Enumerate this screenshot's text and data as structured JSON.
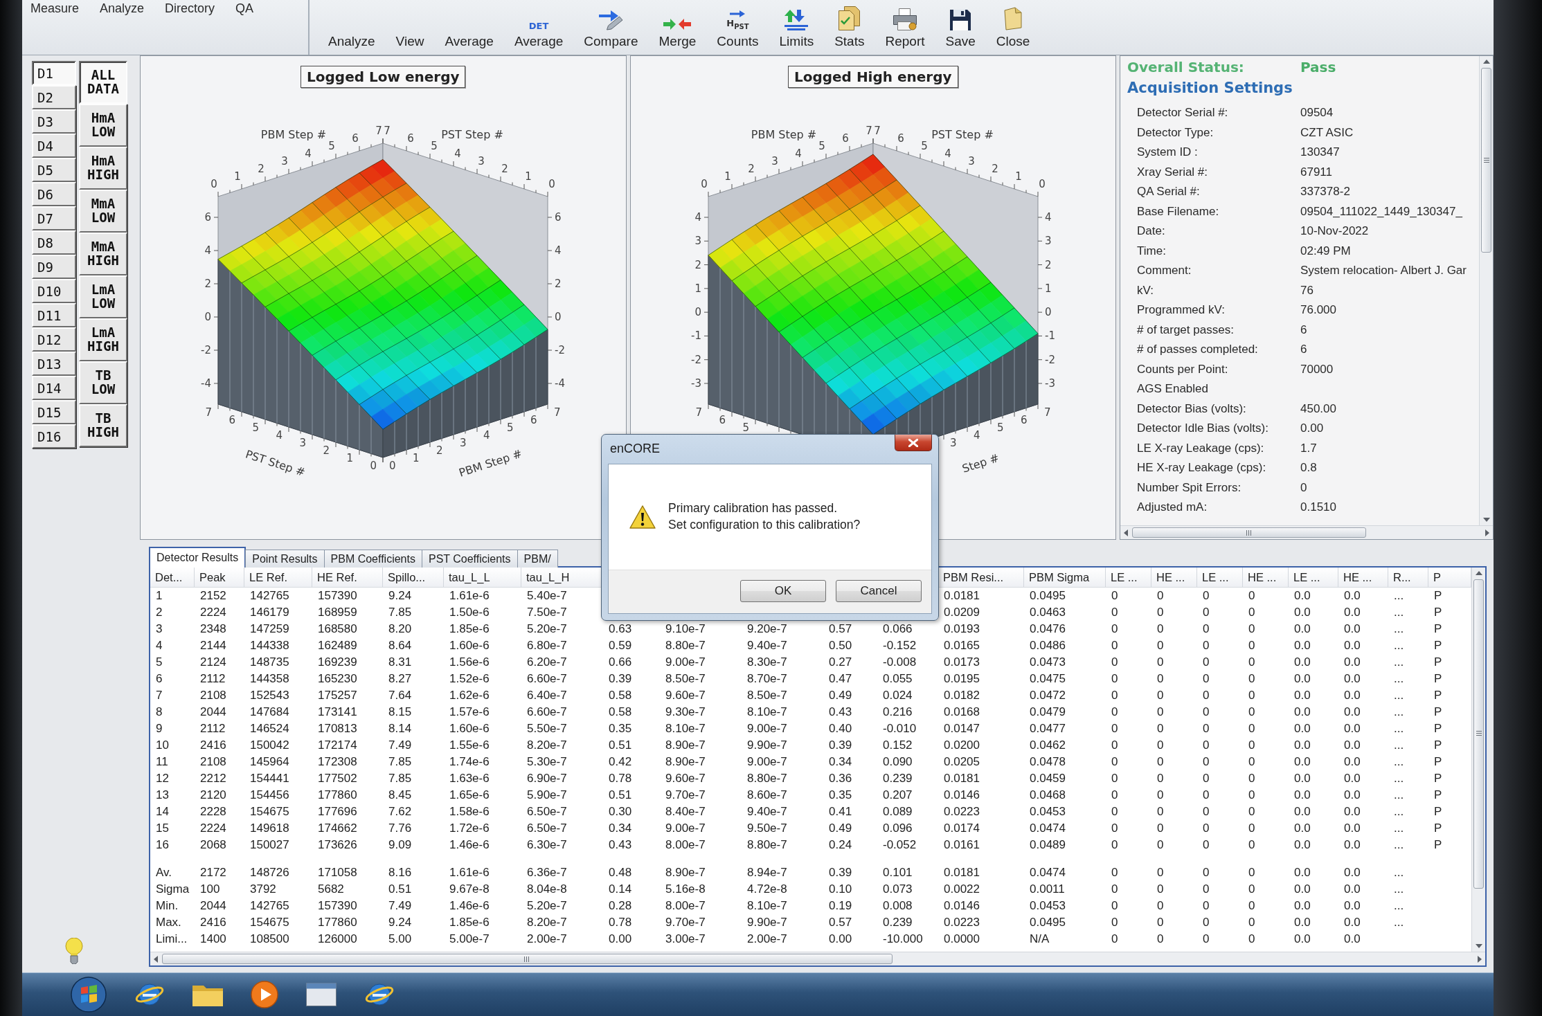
{
  "menu": [
    {
      "label": "Measure"
    },
    {
      "label": "Analyze"
    },
    {
      "label": "Directory"
    },
    {
      "label": "QA"
    }
  ],
  "toolbar": [
    {
      "label": "Analyze",
      "kind": "plain"
    },
    {
      "label": "View",
      "kind": "plain"
    },
    {
      "label": "Average",
      "kind": "plain"
    },
    {
      "label": "Average",
      "kind": "det",
      "icon_text": "DET"
    },
    {
      "label": "Compare",
      "kind": "compare"
    },
    {
      "label": "Merge",
      "kind": "merge"
    },
    {
      "label": "Counts",
      "kind": "counts",
      "icon_text": "H$_{PST}$"
    },
    {
      "label": "Limits",
      "kind": "limits"
    },
    {
      "label": "Stats",
      "kind": "stats"
    },
    {
      "label": "Report",
      "kind": "report"
    },
    {
      "label": "Save",
      "kind": "save"
    },
    {
      "label": "Close",
      "kind": "close"
    }
  ],
  "detector_buttons": [
    {
      "label": "D1",
      "selected": true
    },
    {
      "label": "D2",
      "selected": false
    },
    {
      "label": "D3",
      "selected": false
    },
    {
      "label": "D4",
      "selected": false
    },
    {
      "label": "D5",
      "selected": false
    },
    {
      "label": "D6",
      "selected": false
    },
    {
      "label": "D7",
      "selected": false
    },
    {
      "label": "D8",
      "selected": false
    },
    {
      "label": "D9",
      "selected": false
    },
    {
      "label": "D10",
      "selected": false
    },
    {
      "label": "D11",
      "selected": false
    },
    {
      "label": "D12",
      "selected": false
    },
    {
      "label": "D13",
      "selected": false
    },
    {
      "label": "D14",
      "selected": false
    },
    {
      "label": "D15",
      "selected": false
    },
    {
      "label": "D16",
      "selected": false
    }
  ],
  "mode_buttons": [
    {
      "label": "ALL DATA",
      "selected": true
    },
    {
      "label": "HmA LOW",
      "selected": false
    },
    {
      "label": "HmA HIGH",
      "selected": false
    },
    {
      "label": "MmA LOW",
      "selected": false
    },
    {
      "label": "MmA HIGH",
      "selected": false
    },
    {
      "label": "LmA LOW",
      "selected": false
    },
    {
      "label": "LmA HIGH",
      "selected": false
    },
    {
      "label": "TB LOW",
      "selected": false
    },
    {
      "label": "TB HIGH",
      "selected": false
    }
  ],
  "charts": [
    {
      "title": "Logged Low energy",
      "top_axes": [
        {
          "label": "PBM Step #",
          "ticks": [
            "0",
            "1",
            "2",
            "3",
            "4",
            "5",
            "6",
            "7"
          ]
        },
        {
          "label": "PST Step #",
          "ticks": [
            "7",
            "6",
            "5",
            "4",
            "3",
            "2",
            "1",
            "0"
          ]
        }
      ],
      "left_ticks": [
        "6",
        "4",
        "2",
        "0",
        "-2",
        "-4"
      ],
      "right_ticks": [
        "6",
        "4",
        "2",
        "0",
        "-2",
        "-4"
      ],
      "bottom_axes": [
        {
          "label": "PST Step #",
          "ticks": [
            "7",
            "6",
            "5",
            "4",
            "3",
            "2",
            "1",
            "0"
          ]
        },
        {
          "label": "PBM Step #",
          "ticks": [
            "0",
            "1",
            "2",
            "3",
            "4",
            "5",
            "6",
            "7"
          ]
        }
      ]
    },
    {
      "title": "Logged High energy",
      "top_axes": [
        {
          "label": "PBM Step #",
          "ticks": [
            "0",
            "1",
            "2",
            "3",
            "4",
            "5",
            "6",
            "7"
          ]
        },
        {
          "label": "PST Step #",
          "ticks": [
            "7",
            "6",
            "5",
            "4",
            "3",
            "2",
            "1",
            "0"
          ]
        }
      ],
      "left_ticks": [
        "4",
        "3",
        "2",
        "1",
        "0",
        "-1",
        "-2",
        "-3"
      ],
      "right_ticks": [
        "4",
        "3",
        "2",
        "1",
        "0",
        "-1",
        "-2",
        "-3"
      ],
      "bottom_axes": [
        {
          "ticks": [
            "7",
            "6",
            "5"
          ]
        },
        {
          "label": "Step #",
          "ticks": [
            "3",
            "4",
            "5",
            "6",
            "7"
          ]
        }
      ]
    }
  ],
  "settings_panel": {
    "status": {
      "label": "Overall Status:",
      "value": "Pass"
    },
    "title": "Acquisition Settings",
    "rows": [
      {
        "label": "Detector Serial #:",
        "value": "09504"
      },
      {
        "label": "Detector Type:",
        "value": "CZT ASIC"
      },
      {
        "label": "System ID :",
        "value": "130347"
      },
      {
        "label": "Xray Serial #:",
        "value": "67911"
      },
      {
        "label": "QA Serial #:",
        "value": "337378-2"
      },
      {
        "label": "Base Filename:",
        "value": "09504_111022_1449_130347_"
      },
      {
        "label": "Date:",
        "value": "10-Nov-2022"
      },
      {
        "label": "Time:",
        "value": "02:49 PM"
      },
      {
        "label": "Comment:",
        "value": "System relocation- Albert J. Gar"
      },
      {
        "label": "kV:",
        "value": "76"
      },
      {
        "label": "Programmed kV:",
        "value": "76.000"
      },
      {
        "label": "# of target passes:",
        "value": "6"
      },
      {
        "label": "# of passes completed:",
        "value": "6"
      },
      {
        "label": "Counts per Point:",
        "value": "70000"
      },
      {
        "label": "AGS Enabled"
      },
      {
        "label": "Detector Bias (volts):",
        "value": "450.00"
      },
      {
        "label": "Detector Idle Bias (volts):",
        "value": "0.00"
      },
      {
        "label": "LE X-ray Leakage (cps):",
        "value": "1.7"
      },
      {
        "label": "HE X-ray Leakage (cps):",
        "value": "0.8"
      },
      {
        "label": "Number Spit Errors:",
        "value": "0"
      },
      {
        "label": "Adjusted mA:",
        "value": "0.1510"
      }
    ]
  },
  "results": {
    "tabs": [
      {
        "label": "Detector Results",
        "selected": true
      },
      {
        "label": "Point Results",
        "selected": false
      },
      {
        "label": "PBM Coefficients",
        "selected": false
      },
      {
        "label": "PST Coefficients",
        "selected": false
      },
      {
        "label": "PBM/",
        "selected": false
      }
    ],
    "columns": [
      "Det...",
      "Peak",
      "LE Ref.",
      "HE Ref.",
      "Spillo...",
      "tau_L_L",
      "tau_L_H",
      null,
      null,
      null,
      null,
      null,
      "PBM Resi...",
      "PBM Sigma",
      "LE ...",
      "HE ...",
      "LE ...",
      "HE ...",
      "LE ...",
      "HE ...",
      "R...",
      "P"
    ],
    "rows": [
      [
        "1",
        "2152",
        "142765",
        "157390",
        "9.24",
        "1.61e-6",
        "5.40e-7",
        null,
        null,
        null,
        null,
        null,
        "0.0181",
        "0.0495",
        "0",
        "0",
        "0",
        "0",
        "0.0",
        "0.0",
        "...",
        "P"
      ],
      [
        "2",
        "2224",
        "146179",
        "168959",
        "7.85",
        "1.50e-6",
        "7.50e-7",
        null,
        null,
        null,
        null,
        null,
        "0.0209",
        "0.0463",
        "0",
        "0",
        "0",
        "0",
        "0.0",
        "0.0",
        "...",
        "P"
      ],
      [
        "3",
        "2348",
        "147259",
        "168580",
        "8.20",
        "1.85e-6",
        "5.20e-7",
        "0.63",
        "9.10e-7",
        "9.20e-7",
        "0.57",
        "0.066",
        "0.0193",
        "0.0476",
        "0",
        "0",
        "0",
        "0",
        "0.0",
        "0.0",
        "...",
        "P"
      ],
      [
        "4",
        "2144",
        "144338",
        "162489",
        "8.64",
        "1.60e-6",
        "6.80e-7",
        "0.59",
        "8.80e-7",
        "9.40e-7",
        "0.50",
        "-0.152",
        "0.0165",
        "0.0486",
        "0",
        "0",
        "0",
        "0",
        "0.0",
        "0.0",
        "...",
        "P"
      ],
      [
        "5",
        "2124",
        "148735",
        "169239",
        "8.31",
        "1.56e-6",
        "6.20e-7",
        "0.66",
        "9.00e-7",
        "8.30e-7",
        "0.27",
        "-0.008",
        "0.0173",
        "0.0473",
        "0",
        "0",
        "0",
        "0",
        "0.0",
        "0.0",
        "...",
        "P"
      ],
      [
        "6",
        "2112",
        "144358",
        "165230",
        "8.27",
        "1.52e-6",
        "6.60e-7",
        "0.39",
        "8.50e-7",
        "8.70e-7",
        "0.47",
        "0.055",
        "0.0195",
        "0.0475",
        "0",
        "0",
        "0",
        "0",
        "0.0",
        "0.0",
        "...",
        "P"
      ],
      [
        "7",
        "2108",
        "152543",
        "175257",
        "7.64",
        "1.62e-6",
        "6.40e-7",
        "0.58",
        "9.60e-7",
        "8.50e-7",
        "0.49",
        "0.024",
        "0.0182",
        "0.0472",
        "0",
        "0",
        "0",
        "0",
        "0.0",
        "0.0",
        "...",
        "P"
      ],
      [
        "8",
        "2044",
        "147684",
        "173141",
        "8.15",
        "1.57e-6",
        "6.60e-7",
        "0.58",
        "9.30e-7",
        "8.10e-7",
        "0.43",
        "0.216",
        "0.0168",
        "0.0479",
        "0",
        "0",
        "0",
        "0",
        "0.0",
        "0.0",
        "...",
        "P"
      ],
      [
        "9",
        "2112",
        "146524",
        "170813",
        "8.14",
        "1.60e-6",
        "5.50e-7",
        "0.35",
        "8.10e-7",
        "9.00e-7",
        "0.40",
        "-0.010",
        "0.0147",
        "0.0477",
        "0",
        "0",
        "0",
        "0",
        "0.0",
        "0.0",
        "...",
        "P"
      ],
      [
        "10",
        "2416",
        "150042",
        "172174",
        "7.49",
        "1.55e-6",
        "8.20e-7",
        "0.51",
        "8.90e-7",
        "9.90e-7",
        "0.39",
        "0.152",
        "0.0200",
        "0.0462",
        "0",
        "0",
        "0",
        "0",
        "0.0",
        "0.0",
        "...",
        "P"
      ],
      [
        "11",
        "2108",
        "145964",
        "172308",
        "7.85",
        "1.74e-6",
        "5.30e-7",
        "0.42",
        "8.90e-7",
        "9.00e-7",
        "0.34",
        "0.090",
        "0.0205",
        "0.0478",
        "0",
        "0",
        "0",
        "0",
        "0.0",
        "0.0",
        "...",
        "P"
      ],
      [
        "12",
        "2212",
        "154441",
        "177502",
        "7.85",
        "1.63e-6",
        "6.90e-7",
        "0.78",
        "9.60e-7",
        "8.80e-7",
        "0.36",
        "0.239",
        "0.0181",
        "0.0459",
        "0",
        "0",
        "0",
        "0",
        "0.0",
        "0.0",
        "...",
        "P"
      ],
      [
        "13",
        "2120",
        "154456",
        "177860",
        "8.45",
        "1.65e-6",
        "5.90e-7",
        "0.51",
        "9.70e-7",
        "8.60e-7",
        "0.35",
        "0.207",
        "0.0146",
        "0.0468",
        "0",
        "0",
        "0",
        "0",
        "0.0",
        "0.0",
        "...",
        "P"
      ],
      [
        "14",
        "2228",
        "154675",
        "177696",
        "7.62",
        "1.58e-6",
        "6.50e-7",
        "0.30",
        "8.40e-7",
        "9.40e-7",
        "0.41",
        "0.089",
        "0.0223",
        "0.0453",
        "0",
        "0",
        "0",
        "0",
        "0.0",
        "0.0",
        "...",
        "P"
      ],
      [
        "15",
        "2224",
        "149618",
        "174662",
        "7.76",
        "1.72e-6",
        "6.50e-7",
        "0.34",
        "9.00e-7",
        "9.50e-7",
        "0.49",
        "0.096",
        "0.0174",
        "0.0474",
        "0",
        "0",
        "0",
        "0",
        "0.0",
        "0.0",
        "...",
        "P"
      ],
      [
        "16",
        "2068",
        "150027",
        "173626",
        "9.09",
        "1.46e-6",
        "6.30e-7",
        "0.43",
        "8.00e-7",
        "8.80e-7",
        "0.24",
        "-0.052",
        "0.0161",
        "0.0489",
        "0",
        "0",
        "0",
        "0",
        "0.0",
        "0.0",
        "...",
        "P"
      ]
    ],
    "summary_rows": [
      [
        "Av.",
        "2172",
        "148726",
        "171058",
        "8.16",
        "1.61e-6",
        "6.36e-7",
        "0.48",
        "8.90e-7",
        "8.94e-7",
        "0.39",
        "0.101",
        "0.0181",
        "0.0474",
        "0",
        "0",
        "0",
        "0",
        "0.0",
        "0.0",
        "...",
        null
      ],
      [
        "Sigma",
        "100",
        "3792",
        "5682",
        "0.51",
        "9.67e-8",
        "8.04e-8",
        "0.14",
        "5.16e-8",
        "4.72e-8",
        "0.10",
        "0.073",
        "0.0022",
        "0.0011",
        "0",
        "0",
        "0",
        "0",
        "0.0",
        "0.0",
        "...",
        null
      ],
      [
        "Min.",
        "2044",
        "142765",
        "157390",
        "7.49",
        "1.46e-6",
        "5.20e-7",
        "0.28",
        "8.00e-7",
        "8.10e-7",
        "0.19",
        "0.008",
        "0.0146",
        "0.0453",
        "0",
        "0",
        "0",
        "0",
        "0.0",
        "0.0",
        "...",
        null
      ],
      [
        "Max.",
        "2416",
        "154675",
        "177860",
        "9.24",
        "1.85e-6",
        "8.20e-7",
        "0.78",
        "9.70e-7",
        "9.90e-7",
        "0.57",
        "0.239",
        "0.0223",
        "0.0495",
        "0",
        "0",
        "0",
        "0",
        "0.0",
        "0.0",
        "...",
        null
      ],
      [
        "Limi...",
        "1400",
        "108500",
        "126000",
        "5.00",
        "5.00e-7",
        "2.00e-7",
        "0.00",
        "3.00e-7",
        "2.00e-7",
        "0.00",
        "-10.000",
        "0.0000",
        "N/A",
        "0",
        "0",
        "0",
        "0",
        "0.0",
        "0.0",
        null,
        null
      ]
    ]
  },
  "dialog": {
    "title": "enCORE",
    "message": "Primary calibration has passed.\nSet configuration to this calibration?",
    "buttons": [
      {
        "label": "OK"
      },
      {
        "label": "Cancel"
      }
    ]
  }
}
